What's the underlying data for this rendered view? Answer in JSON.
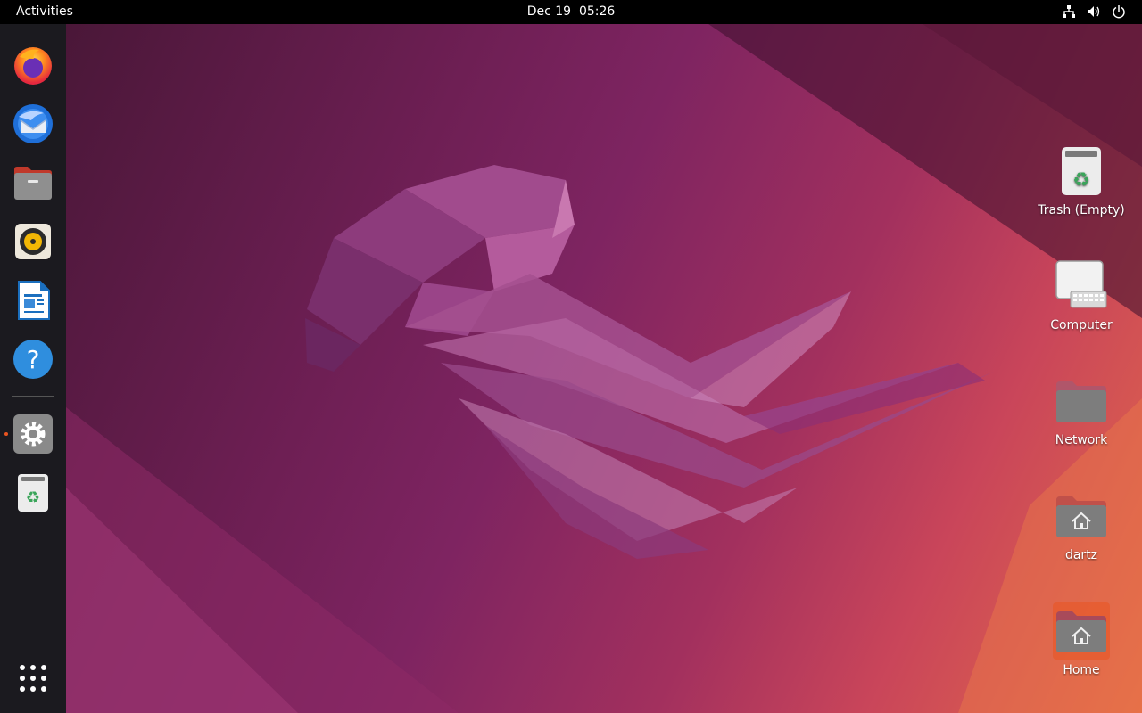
{
  "topbar": {
    "activities": "Activities",
    "date": "Dec 19",
    "time": "05:26"
  },
  "dock": {
    "apps": [
      {
        "name": "Firefox",
        "icon": "firefox-icon"
      },
      {
        "name": "Thunderbird",
        "icon": "thunderbird-icon"
      },
      {
        "name": "Files",
        "icon": "files-icon"
      },
      {
        "name": "Rhythmbox",
        "icon": "rhythmbox-icon"
      },
      {
        "name": "LibreOffice Writer",
        "icon": "writer-icon"
      },
      {
        "name": "Help",
        "icon": "help-icon"
      },
      {
        "name": "Settings",
        "icon": "settings-icon",
        "running": true
      },
      {
        "name": "Trash",
        "icon": "trash-icon"
      }
    ],
    "show_apps_icon": "app-grid-icon"
  },
  "desktop": {
    "icons": [
      {
        "label": "Trash (Empty)",
        "icon": "trash-icon"
      },
      {
        "label": "Computer",
        "icon": "computer-icon"
      },
      {
        "label": "Network",
        "icon": "folder-icon"
      },
      {
        "label": "dartz",
        "icon": "home-folder-icon"
      },
      {
        "label": "Home",
        "icon": "home-folder-icon",
        "selected": true
      }
    ]
  },
  "colors": {
    "accent": "#e95420",
    "dock_bg": "#1b1a1f",
    "topbar_bg": "#000000"
  }
}
